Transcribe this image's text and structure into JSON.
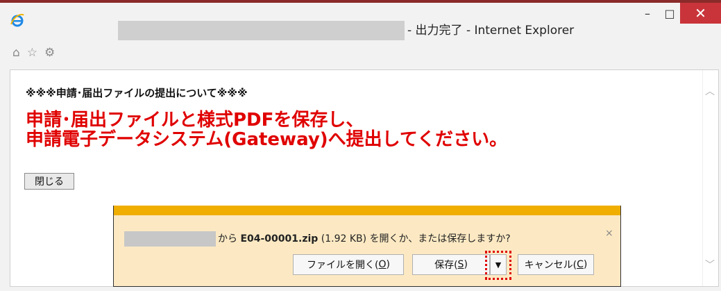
{
  "window": {
    "title_suffix": "- 出力完了 - Internet Explorer",
    "minimize_glyph": "–",
    "maximize_glyph": "□",
    "close_glyph": "✕"
  },
  "favorites_bar": {
    "icons": [
      "home-icon",
      "star-icon",
      "gear-icon"
    ],
    "home_glyph": "⌂",
    "star_glyph": "☆",
    "gear_glyph": "⚙"
  },
  "page": {
    "heading": "※※※申請･届出ファイルの提出について※※※",
    "message_line1": "申請･届出ファイルと様式PDFを保存し、",
    "message_line2": "申請電子データシステム(Gateway)へ提出してください。",
    "close_button_label": "閉じる"
  },
  "download_bar": {
    "from_text": "から",
    "filename": "E04-00001.zip",
    "size": "(1.92 KB)",
    "question": "を開くか、または保存しますか?",
    "close_glyph": "×",
    "open_button_text": "ファイルを開く(",
    "open_button_key": "O",
    "save_button_text": "保存(",
    "save_button_key": "S",
    "dropdown_glyph": "▼",
    "cancel_button_text": "キャンセル(",
    "cancel_button_key": "C",
    "paren_close": ")",
    "accent_color": "#f0ae00",
    "highlight_color": "#e00000"
  }
}
